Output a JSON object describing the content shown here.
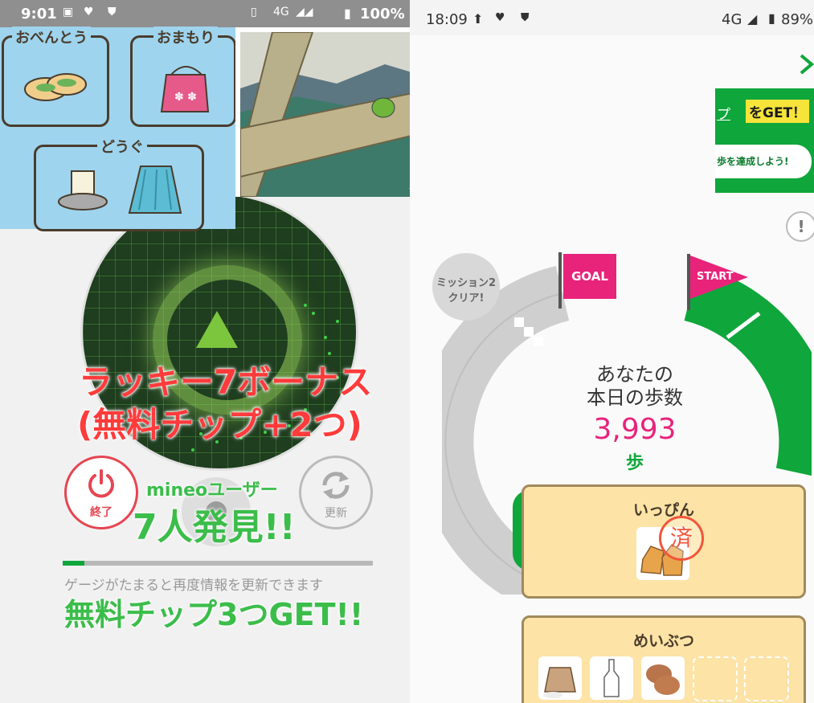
{
  "left_screen": {
    "status_bar": {
      "time": "9:01",
      "network": "4G",
      "battery": "100%"
    },
    "inventory": {
      "bento_label": "おべんとう",
      "charm_label": "おまもり",
      "tool_label": "どうぐ"
    },
    "bonus": {
      "line1": "ラッキー7ボーナス",
      "line2": "(無料チップ+2つ)"
    },
    "found": {
      "user_label": "mineoユーザー",
      "count_text": "7人発見!!"
    },
    "end_button_label": "終了",
    "refresh_button_label": "更新",
    "gauge": {
      "fill_fraction": 0.07,
      "caption": "ゲージがたまると再度情報を更新できます"
    },
    "chip_get": "無料チップ3つGET!!"
  },
  "right_screen": {
    "status_bar": {
      "time": "18:09",
      "network": "4G",
      "battery": "89%"
    },
    "banner": {
      "get_text": "をGET！",
      "chip_part": "プ",
      "mission_text": "歩を達成しよう!"
    },
    "mission_badge": {
      "line1": "ミッション2",
      "line2": "クリア!"
    },
    "goal_flag": "GOAL",
    "start_flag": "START",
    "steps": {
      "label_line1": "あなたの",
      "label_line2": "本日の歩数",
      "value": "3,993",
      "unit": "歩"
    },
    "cards": {
      "ippin": {
        "title": "いっぴん",
        "stamp": "済"
      },
      "meibutsu": {
        "title": "めいぶつ"
      }
    }
  },
  "colors": {
    "accent_green": "#0fa63b",
    "pink": "#e8237a",
    "red_text": "#ff3b3b",
    "card_yellow": "#fde3a6",
    "inventory_blue": "#9ed4ee"
  }
}
